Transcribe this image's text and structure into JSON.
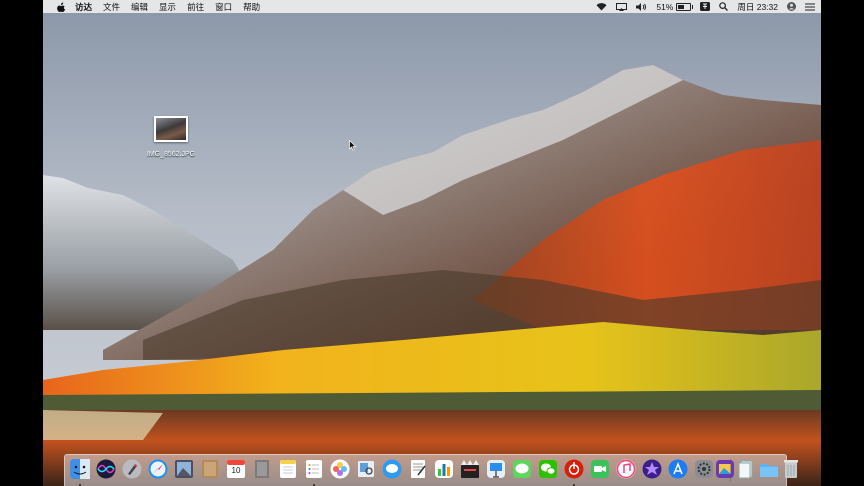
{
  "menubar": {
    "apple_icon": "apple-icon",
    "items": [
      "访达",
      "文件",
      "编辑",
      "显示",
      "前往",
      "窗口",
      "帮助"
    ],
    "status": {
      "battery_percent": "51%",
      "battery_level": 0.51,
      "clock": "周日 23:32",
      "icons": [
        "wifi-icon",
        "airplay-icon",
        "volume-icon",
        "battery-icon",
        "input-method-icon",
        "spotlight-icon",
        "user-icon",
        "siri-icon"
      ]
    }
  },
  "desktop": {
    "file_label": "IMG_8562.JPG",
    "file_icon": "image-file-icon"
  },
  "dock": {
    "calendar_day": "10",
    "apps": [
      "finder",
      "siri",
      "launchpad",
      "safari",
      "photo-booth",
      "notes-brown",
      "calendar",
      "sketch-grey",
      "notes",
      "reminders",
      "photos",
      "preview",
      "textedit",
      "numbers",
      "final-cut",
      "keynote",
      "messages",
      "wechat",
      "netease-music",
      "facetime",
      "itunes",
      "imovie-star",
      "app-store",
      "system-preferences",
      "photos-extra",
      "trash-area"
    ],
    "colors": {
      "finder": "#3f8ee8",
      "safari": "#1f8ff0",
      "app_store": "#1c7cf4",
      "wechat": "#2dc100",
      "netease": "#d81e06",
      "itunes": "#f83b7a"
    }
  }
}
